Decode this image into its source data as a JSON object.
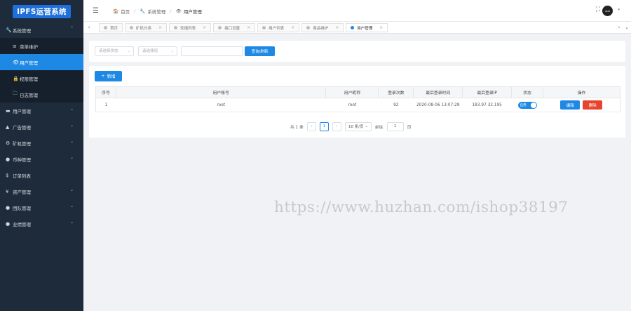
{
  "sidebar": {
    "logo": "IPFS运营系统",
    "items": [
      {
        "icon": "🔧",
        "label": "系统管理",
        "arrow": "⌃"
      },
      {
        "icon": "≡",
        "label": "菜单维护"
      },
      {
        "icon": "👁",
        "label": "用户管理"
      },
      {
        "icon": "🔒",
        "label": "权限管理"
      },
      {
        "icon": "🗀",
        "label": "日志管理"
      },
      {
        "icon": "▬",
        "label": "用户管理",
        "arrow": "⌄"
      },
      {
        "icon": "▲",
        "label": "广告管理",
        "arrow": "⌄"
      },
      {
        "icon": "⚙",
        "label": "矿机管理",
        "arrow": "⌄"
      },
      {
        "icon": "●",
        "label": "币种管理",
        "arrow": "⌄"
      },
      {
        "icon": "$",
        "label": "订单列表"
      },
      {
        "icon": "¥",
        "label": "资产管理",
        "arrow": "⌄"
      },
      {
        "icon": "●",
        "label": "团队管理",
        "arrow": "⌄"
      },
      {
        "icon": "●",
        "label": "业绩管理",
        "arrow": "⌄"
      }
    ]
  },
  "topbar": {
    "hamburger": "☰",
    "breadcrumb": [
      {
        "icon": "🏠",
        "label": "首页"
      },
      {
        "icon": "🔧",
        "label": "系统管理"
      },
      {
        "icon": "👁",
        "label": "用户管理"
      }
    ],
    "fullscreen_icon": "⛶",
    "avatar_text": "user",
    "caret": "▾"
  },
  "tabbar": {
    "prev": "‹",
    "next": "›",
    "more": "⌄",
    "close": "×",
    "tabs": [
      "首页",
      "矿机分类",
      "轮播列表",
      "接口设置",
      "用户列表",
      "商品维护",
      "用户管理"
    ]
  },
  "filters": {
    "status_placeholder": "请选择状态",
    "group_placeholder": "请选择组",
    "search_placeholder": "",
    "query_button": "查询/刷新",
    "caret": "⌄"
  },
  "main": {
    "add_button": "新增",
    "add_icon": "+",
    "columns": [
      "序号",
      "用户账号",
      "用户昵称",
      "登录次数",
      "最后登录时间",
      "最后登录IP",
      "状态",
      "操作"
    ],
    "rows": [
      {
        "index": "1",
        "account": "root",
        "nickname": "root",
        "logins": "92",
        "last_login": "2020-08-06 13:07:28",
        "last_ip": "183.97.32.195",
        "status": "启用",
        "edit": "编辑",
        "delete": "删除"
      }
    ]
  },
  "pager": {
    "total": "共 1 条",
    "prev": "‹",
    "page": "1",
    "next": "›",
    "page_size": "10 条/页",
    "goto_prefix": "前往",
    "goto_value": "1",
    "goto_suffix": "页"
  },
  "watermark": "https://www.huzhan.com/ishop38197"
}
